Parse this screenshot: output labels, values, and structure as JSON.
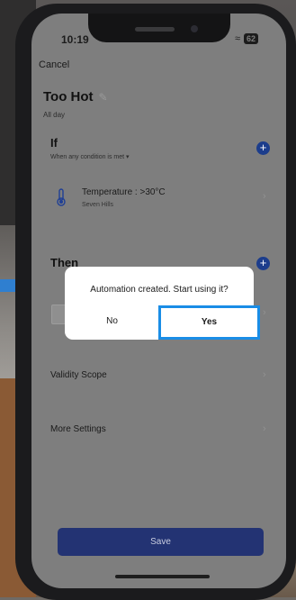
{
  "status_bar": {
    "time": "10:19",
    "battery": "62"
  },
  "header": {
    "cancel_label": "Cancel",
    "title": "Too Hot",
    "subtitle": "All day"
  },
  "if_section": {
    "label": "If",
    "subtitle": "When any condition is met ▾",
    "condition": {
      "title": "Temperature : >30°C",
      "location": "Seven Hills"
    }
  },
  "then_section": {
    "label": "Then"
  },
  "rows": {
    "validity_scope": "Validity Scope",
    "more_settings": "More Settings"
  },
  "footer": {
    "save_label": "Save"
  },
  "dialog": {
    "message": "Automation created. Start using it?",
    "no_label": "No",
    "yes_label": "Yes"
  },
  "colors": {
    "accent": "#1c3d8c",
    "save_button": "#233373",
    "highlight": "#1a8de6"
  }
}
